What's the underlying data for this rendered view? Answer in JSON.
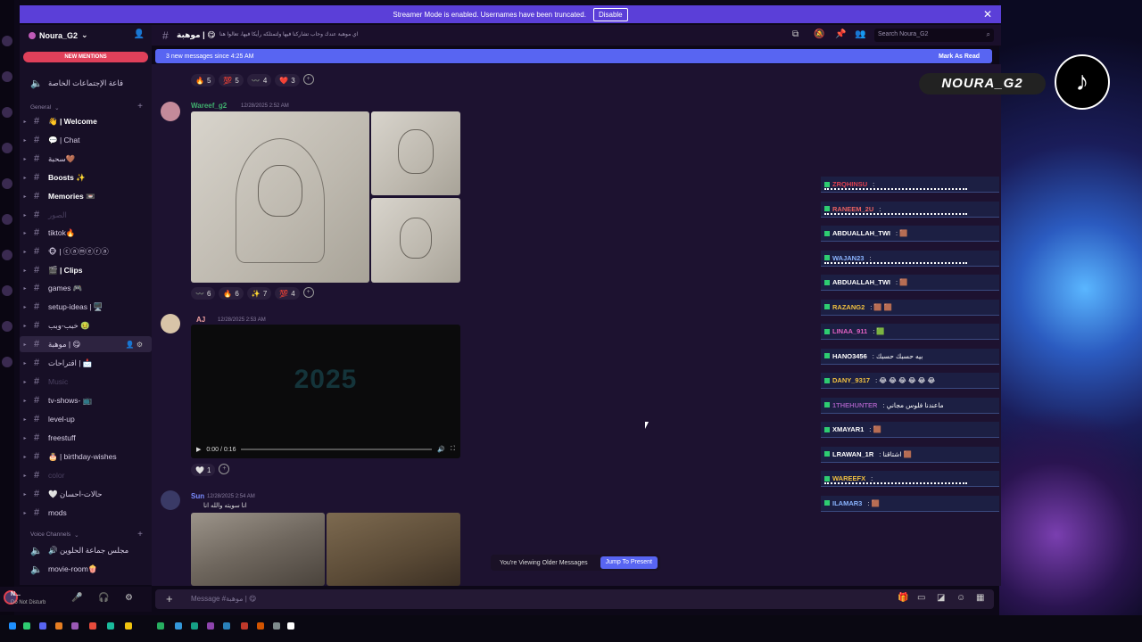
{
  "banner": {
    "text": "Streamer Mode is enabled. Usernames have been truncated.",
    "disable": "Disable"
  },
  "server": {
    "name": "Noura_G2",
    "new_mentions": "NEW MENTIONS",
    "pinned_channel": "قاعة الإجتماعات الخاصة"
  },
  "categories": {
    "general": "General",
    "voice": "Voice Channels"
  },
  "channels": [
    {
      "name": "👋 | Welcome",
      "bold": true
    },
    {
      "name": "💬 | Chat",
      "bold": false
    },
    {
      "name": "سحبة🤎",
      "bold": false
    },
    {
      "name": "Boosts ✨",
      "bold": true
    },
    {
      "name": "Memories 📼",
      "bold": true
    },
    {
      "name": "الصور",
      "bold": false,
      "dim": true
    },
    {
      "name": "tiktok🔥",
      "bold": false
    },
    {
      "name": "🐵 | ⓒⓐⓜⓔⓡⓐ",
      "bold": false
    },
    {
      "name": "🎬 | Clips",
      "bold": true
    },
    {
      "name": "games 🎮",
      "bold": false
    },
    {
      "name": "setup-ideas | 🖥️",
      "bold": false
    },
    {
      "name": "خبب-وبب 🤢",
      "bold": false
    },
    {
      "name": "موهبة | 😋",
      "bold": false,
      "active": true
    },
    {
      "name": "اقتراحات | 📩",
      "bold": false
    },
    {
      "name": "Music",
      "bold": false,
      "dim": true
    },
    {
      "name": "tv-shows- 📺",
      "bold": false
    },
    {
      "name": "level-up",
      "bold": false
    },
    {
      "name": "freestuff",
      "bold": false
    },
    {
      "name": "🎂 | birthday-wishes",
      "bold": false
    },
    {
      "name": "color",
      "bold": false,
      "dim": true
    },
    {
      "name": "🤍 حالات-احسان",
      "bold": false
    },
    {
      "name": "mods",
      "bold": false
    }
  ],
  "voice_channels": [
    {
      "name": "🔊 مجلس جماعة الحلوين"
    },
    {
      "name": "movie-room🍿"
    }
  ],
  "user": {
    "name": "N...",
    "status": "Do Not Disturb"
  },
  "header": {
    "channel": "موهبة | 😋",
    "topic": "اي موهبة عندك وحاب تشاركنا فيها ولتمتلكه رأيكا فيها، تعالوا هنا",
    "search": "Search Noura_G2"
  },
  "new_messages": {
    "text": "3 new messages since 4:25 AM",
    "mark": "Mark As Read"
  },
  "messages": [
    {
      "reactions": [
        {
          "e": "🔥",
          "n": "5"
        },
        {
          "e": "💯",
          "n": "5"
        },
        {
          "e": "〰️",
          "n": "4"
        },
        {
          "e": "❤️",
          "n": "3"
        }
      ]
    },
    {
      "author": "Wareef_g2",
      "time": "12/28/2025 2:52 AM",
      "author_color": "#3fae6d",
      "reactions": [
        {
          "e": "〰️",
          "n": "6"
        },
        {
          "e": "🔥",
          "n": "6"
        },
        {
          "e": "✨",
          "n": "7"
        },
        {
          "e": "💯",
          "n": "4"
        }
      ]
    },
    {
      "author": "AJ",
      "time": "12/28/2025 2:53 AM",
      "author_color": "#f0a0a0",
      "video": {
        "text": "2025",
        "time": "0:00 / 0:16"
      },
      "reactions": [
        {
          "e": "🤍",
          "n": "1"
        }
      ]
    },
    {
      "author": "Sun",
      "time": "12/28/2025 2:54 AM",
      "author_color": "#7a8cff",
      "body": "انا سويته والله انا"
    }
  ],
  "toast": {
    "text": "You're Viewing Older Messages",
    "jump": "Jump To Present"
  },
  "composer": {
    "placeholder": "Message #موهبة | 😋"
  },
  "overlay": [
    {
      "name": "ZRQHINSU",
      "color": "#e04050",
      "msg": ":",
      "wave": true
    },
    {
      "name": "RANEEM_2U",
      "color": "#e86060",
      "msg": ":",
      "wave": true
    },
    {
      "name": "ABDUALLAH_TWI",
      "color": "#ffffff",
      "msg": ": 🟫"
    },
    {
      "name": "WAJAN23",
      "color": "#8ab4ff",
      "msg": ":",
      "wave": true
    },
    {
      "name": "ABDUALLAH_TWI",
      "color": "#ffffff",
      "msg": ": 🟫"
    },
    {
      "name": "RAZANG2",
      "color": "#f0c040",
      "msg": ": 🟫 🟫"
    },
    {
      "name": "LINAA_911",
      "color": "#e060c0",
      "msg": ": 🟩"
    },
    {
      "name": "HANO3456",
      "color": "#ffffff",
      "msg": ": بيه حسبك حسبك"
    },
    {
      "name": "DANY_9317",
      "color": "#f0c040",
      "msg": ": 😂 😂 😂 😂 😂 😂"
    },
    {
      "name": "1THEHUNTER",
      "color": "#9b59b6",
      "msg": ": ماعندنا فلوس مجاني"
    },
    {
      "name": "XMAYAR1",
      "color": "#ffffff",
      "msg": ": 🟫"
    },
    {
      "name": "LRAWAN_1R",
      "color": "#ffffff",
      "msg": ": اشتاقنا 🟫"
    },
    {
      "name": "WAREEFX",
      "color": "#f0c040",
      "msg": ":",
      "wave": true
    },
    {
      "name": "ILAMAR3",
      "color": "#8ab4ff",
      "msg": ": 🟫"
    }
  ],
  "watermark": {
    "name": "NOURA_G2",
    "tiktok_icon": "tiktok-icon"
  }
}
